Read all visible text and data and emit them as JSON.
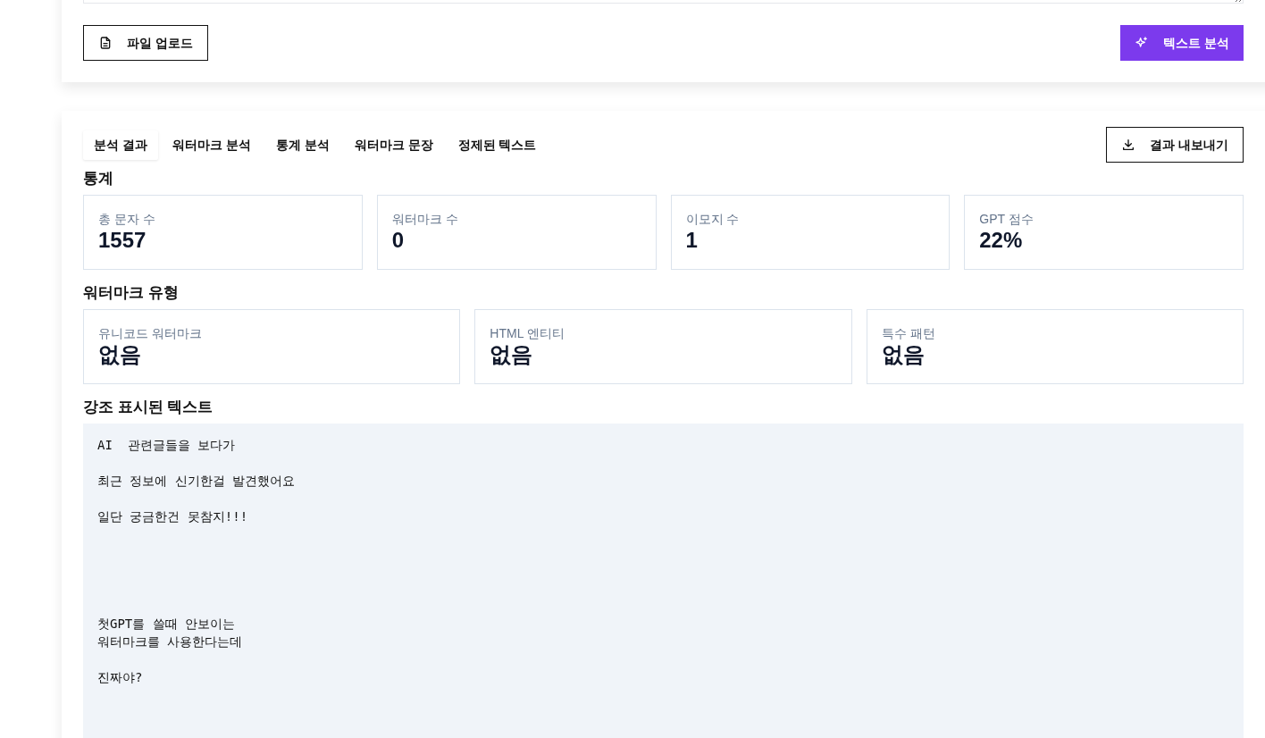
{
  "input_card": {
    "upload_button": "파일 업로드",
    "analyze_button": "텍스트 분석"
  },
  "tabs": [
    {
      "label": "분석 결과",
      "selected": true
    },
    {
      "label": "워터마크 분석",
      "selected": false
    },
    {
      "label": "통계 분석",
      "selected": false
    },
    {
      "label": "워터마크 문장",
      "selected": false
    },
    {
      "label": "정제된 텍스트",
      "selected": false
    }
  ],
  "export_button": "결과 내보내기",
  "statistics": {
    "title": "통계",
    "items": [
      {
        "label": "총 문자 수",
        "value": "1557"
      },
      {
        "label": "워터마크 수",
        "value": "0"
      },
      {
        "label": "이모지 수",
        "value": "1"
      },
      {
        "label": "GPT 점수",
        "value": "22%"
      }
    ]
  },
  "watermark_types": {
    "title": "워터마크 유형",
    "items": [
      {
        "label": "유니코드 워터마크",
        "value": "없음"
      },
      {
        "label": "HTML 엔티티",
        "value": "없음"
      },
      {
        "label": "특수 패턴",
        "value": "없음"
      }
    ]
  },
  "highlighted": {
    "title": "강조 표시된 텍스트",
    "text": "AI  관련글들을 보다가\n\n최근 정보에 신기한걸 발견했어요\n\n일단 궁금한건 못참지!!!\n\n\n\n\n\n첫GPT를 쓸때 안보이는\n워터마크를 사용한다는데\n\n진짜야?"
  }
}
